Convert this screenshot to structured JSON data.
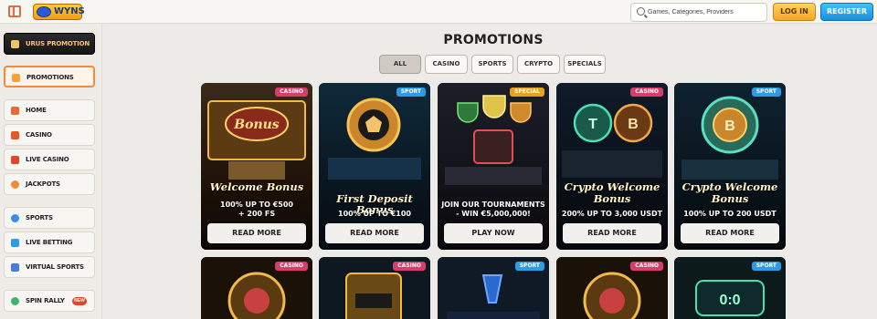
{
  "header": {
    "logo_text": "WYNS",
    "search_placeholder": "Games, Categories, Providers",
    "login_label": "LOG IN",
    "register_label": "REGISTER"
  },
  "sidebar": {
    "promo_label": "URUS PROMOTION",
    "items": [
      {
        "label": "PROMOTIONS",
        "icon": "gift-icon",
        "active": true
      },
      {
        "label": "HOME",
        "icon": "home-icon"
      },
      {
        "label": "CASINO",
        "icon": "casino-icon"
      },
      {
        "label": "LIVE CASINO",
        "icon": "live-casino-icon"
      },
      {
        "label": "JACKPOTS",
        "icon": "jackpot-icon"
      },
      {
        "label": "SPORTS",
        "icon": "sports-icon"
      },
      {
        "label": "LIVE BETTING",
        "icon": "live-betting-icon"
      },
      {
        "label": "VIRTUAL SPORTS",
        "icon": "virtual-sports-icon"
      },
      {
        "label": "SPIN RALLY",
        "icon": "spin-rally-icon",
        "badge": "NEW"
      }
    ]
  },
  "main": {
    "title": "PROMOTIONS",
    "tabs": [
      {
        "label": "ALL",
        "active": true
      },
      {
        "label": "CASINO"
      },
      {
        "label": "SPORTS"
      },
      {
        "label": "CRYPTO"
      },
      {
        "label": "SPECIALS"
      }
    ],
    "cards": [
      {
        "tag": "CASINO",
        "title_line1": "Welcome Bonus",
        "title_line2": "",
        "sub_line1": "100% UP TO €500",
        "sub_line2": "+ 200 FS",
        "cta": "READ MORE"
      },
      {
        "tag": "SPORT",
        "title_line1": "First Deposit Bonus",
        "title_line2": "",
        "sub_line1": "100% UP TO €100",
        "sub_line2": "",
        "cta": "READ MORE"
      },
      {
        "tag": "SPECIAL",
        "title_line1": "",
        "title_line2": "",
        "sub_line1": "JOIN OUR TOURNAMENTS",
        "sub_line2": "- WIN €5,000,000!",
        "cta": "PLAY NOW"
      },
      {
        "tag": "CASINO",
        "title_line1": "Crypto Welcome",
        "title_line2": "Bonus",
        "sub_line1": "200% UP TO 3,000 USDT",
        "sub_line2": "",
        "cta": "READ MORE"
      },
      {
        "tag": "SPORT",
        "title_line1": "Crypto Welcome",
        "title_line2": "Bonus",
        "sub_line1": "100% UP TO 200 USDT",
        "sub_line2": "",
        "cta": "READ MORE"
      }
    ],
    "second_row_tags": [
      "CASINO",
      "CASINO",
      "SPORT",
      "CASINO",
      "SPORT"
    ]
  },
  "colors": {
    "accent_orange": "#f08a3c",
    "login_yellow": "#f6a623",
    "register_blue": "#1a8ee0",
    "tag_casino": "#d63d6c",
    "tag_sport": "#2d9be6",
    "tag_special": "#e9a21b"
  }
}
